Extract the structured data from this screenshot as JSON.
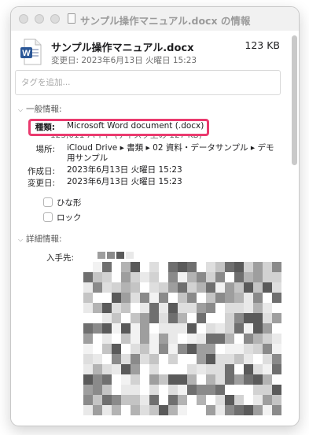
{
  "window": {
    "title": "サンプル操作マニュアル.docx の情報"
  },
  "file": {
    "name": "サンプル操作マニュアル.docx",
    "size": "123 KB",
    "modified_line": "変更日: 2023年6月13日 火曜日 15:23",
    "icon_letter": "W"
  },
  "tags": {
    "placeholder": "タグを追加..."
  },
  "general": {
    "header": "一般情報:",
    "kind_label": "種類:",
    "kind_value": "Microsoft Word document (.docx)",
    "size_value_partial": "123,011 バイト (ディスク上の 127 KB)",
    "where_label": "場所:",
    "where_value": "iCloud Drive ▸ 書類 ▸ 02 資料・データサンプル ▸ デモ用サンプル",
    "created_label": "作成日:",
    "created_value": "2023年6月13日 火曜日 15:23",
    "modified_label": "変更日:",
    "modified_value": "2023年6月13日 火曜日 15:23",
    "stationery_label": "ひな形",
    "locked_label": "ロック"
  },
  "details": {
    "header": "詳細情報:",
    "source_label": "入手先:"
  },
  "colors": {
    "highlight": "#ea3a6e",
    "word_blue": "#2b5797"
  }
}
